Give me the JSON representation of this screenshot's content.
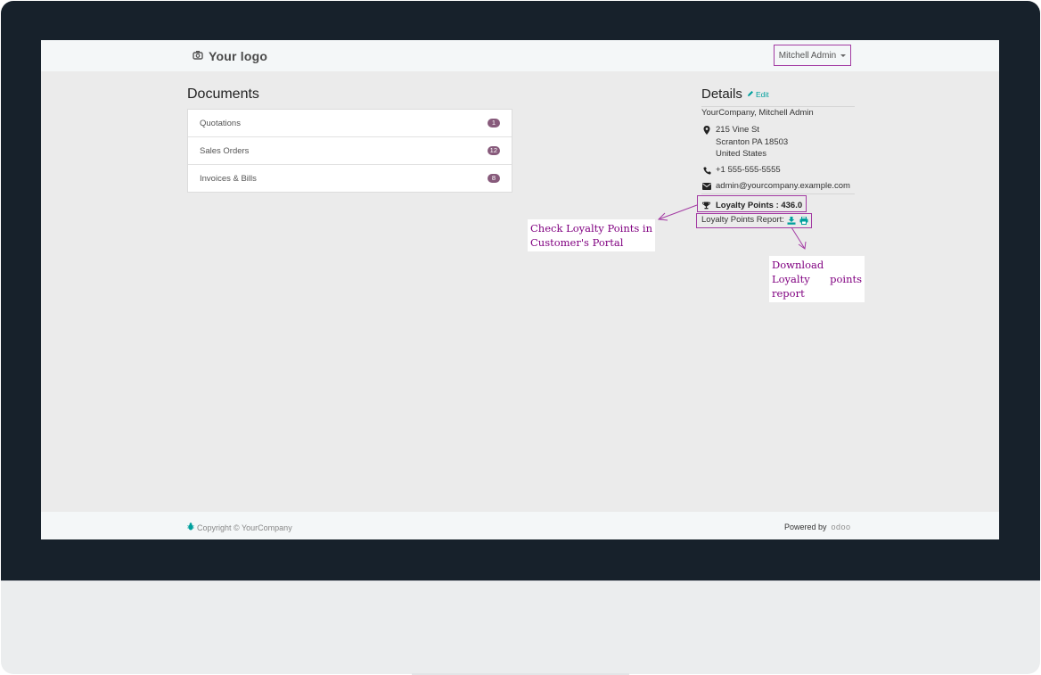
{
  "header": {
    "logo_text": "Your logo",
    "user_menu_label": "Mitchell Admin"
  },
  "documents": {
    "title": "Documents",
    "items": [
      {
        "label": "Quotations",
        "count": "1"
      },
      {
        "label": "Sales Orders",
        "count": "12"
      },
      {
        "label": "Invoices & Bills",
        "count": "8"
      }
    ]
  },
  "details": {
    "title": "Details",
    "edit_label": "Edit",
    "company_contact": "YourCompany, Mitchell Admin",
    "address_line1": "215 Vine St",
    "address_line2": "Scranton PA 18503",
    "address_line3": "United States",
    "phone": "+1 555-555-5555",
    "email": "admin@yourcompany.example.com",
    "loyalty_points": "Loyalty Points : 436.0",
    "loyalty_report_label": "Loyalty Points Report:"
  },
  "annotations": {
    "portal_note": "Check Loyalty Points in Customer's Portal",
    "download_note": "Download Loyalty points report"
  },
  "footer": {
    "copyright": "Copyright © YourCompany",
    "powered_by": "Powered by",
    "brand": "odoo"
  },
  "colors": {
    "accent": "#875a7b",
    "link": "#00a09d",
    "highlight": "#a33ba3",
    "annotation_text": "#800080"
  }
}
